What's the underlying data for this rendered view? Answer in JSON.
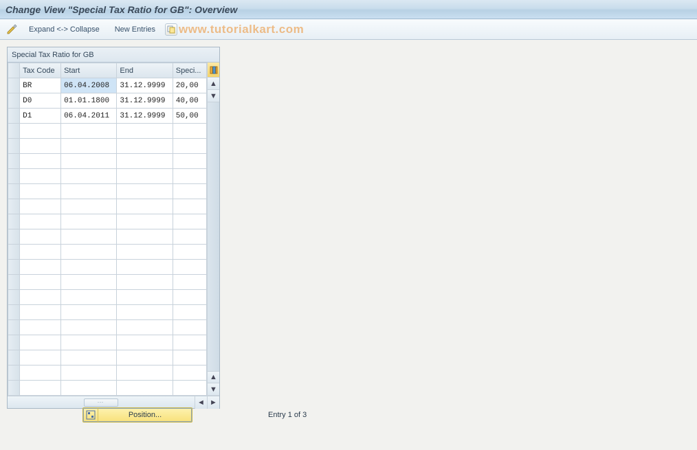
{
  "titlebar": {
    "title": "Change View \"Special Tax Ratio for GB\": Overview"
  },
  "toolbar": {
    "expand_collapse_label": "Expand <-> Collapse",
    "new_entries_label": "New Entries",
    "watermark": "www.tutorialkart.com"
  },
  "grid": {
    "title": "Special Tax Ratio for GB",
    "columns": {
      "tax_code": "Tax Code",
      "start": "Start",
      "end": "End",
      "special": "Speci..."
    },
    "rows": [
      {
        "tax_code": "BR",
        "start": "06.04.2008",
        "end": "31.12.9999",
        "special": "20,00",
        "selected_col": "start"
      },
      {
        "tax_code": "D0",
        "start": "01.01.1800",
        "end": "31.12.9999",
        "special": "40,00"
      },
      {
        "tax_code": "D1",
        "start": "06.04.2011",
        "end": "31.12.9999",
        "special": "50,00"
      }
    ],
    "empty_rows": 18
  },
  "footer": {
    "position_label": "Position...",
    "entry_text": "Entry 1 of 3"
  },
  "icons": {
    "pencil": "pencil-ruler-icon",
    "copy": "copy-icon",
    "configure": "configure-columns-icon",
    "position": "position-locator-icon",
    "up": "▲",
    "down": "▼",
    "left": "◄",
    "right": "►"
  }
}
